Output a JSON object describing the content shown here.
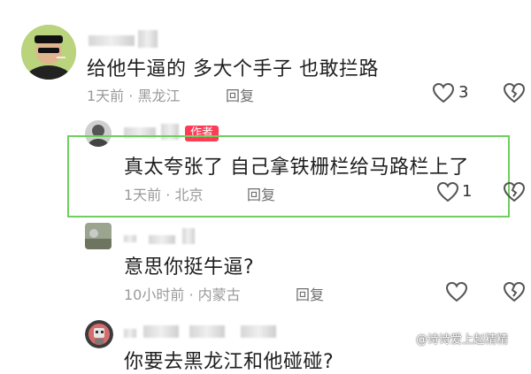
{
  "comments": [
    {
      "text": "给他牛逼的 多大个手子 也敢拦路",
      "time": "1天前",
      "location": "黑龙江",
      "reply_label": "回复",
      "likes": "3"
    },
    {
      "author_tag": "作者",
      "text": "真太夸张了 自己拿铁栅栏给马路栏上了",
      "time": "1天前",
      "location": "北京",
      "reply_label": "回复",
      "likes": "1"
    },
    {
      "text": "意思你挺牛逼?",
      "time": "10小时前",
      "location": "内蒙古",
      "reply_label": "回复"
    },
    {
      "text": "你要去黑龙江和他碰碰?"
    }
  ],
  "separator": "·",
  "watermark": "@诗诗爱上赵精精",
  "colors": {
    "highlight_border": "#6fcf5f",
    "author_tag": "#ff3b55"
  }
}
